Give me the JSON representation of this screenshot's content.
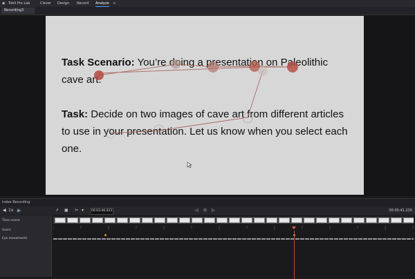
{
  "titlebar": {
    "app": "Tobii Pro Lab",
    "menu": [
      "Clever",
      "Design",
      "Record",
      "Analyze"
    ],
    "active": "Analyze",
    "add": "+"
  },
  "tab": {
    "label": "Recording3"
  },
  "slide": {
    "p1_bold": "Task Scenario:",
    "p1_text": " You’re doing a presentation on Paleolithic cave art.",
    "p2_bold": "Task:",
    "p2_text": " Decide on two images of cave art from different articles to use in your presentation. Let us know when you select each one."
  },
  "overlay": {
    "fixation_color": "#b44a3f"
  },
  "panel": {
    "title": "Index Recording",
    "timecode": "00:03:46.023",
    "duration": "00:05:41.235",
    "rows": [
      "Time scene",
      "Users",
      "Eye movements"
    ]
  },
  "colors": {
    "accent": "#4aa3ff",
    "playhead": "#c04a3a"
  },
  "icons": [
    "app-logo-icon",
    "add-tab-icon",
    "scissors-icon",
    "speaker-icon",
    "play-icon"
  ]
}
